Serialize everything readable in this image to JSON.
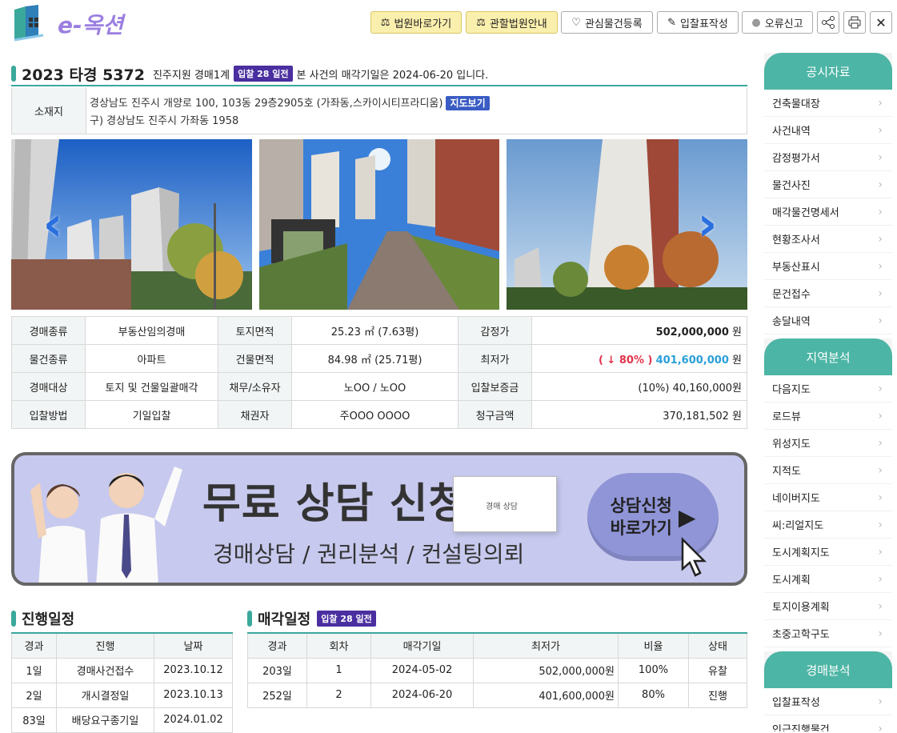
{
  "header": {
    "logo_text": "e-옥션",
    "buttons": {
      "court_link": "법원바로가기",
      "court_info": "관할법원안내",
      "favorite": "관심물건등록",
      "bid_form": "입찰표작성",
      "error_report": "오류신고"
    }
  },
  "title": {
    "case_no": "2023 타경 5372",
    "court": "진주지원 경매1계",
    "dday_badge": "입찰 28 일전",
    "sub": "본 사건의 매각기일은 2024-06-20 입니다."
  },
  "address": {
    "label": "소재지",
    "line1": "경상남도 진주시 개양로 100, 103동 29층2905호 (가좌동,스카이시티프라디움)",
    "map_button": "지도보기",
    "line2": "구) 경상남도 진주시 가좌동 1958"
  },
  "info": {
    "r1": {
      "h1": "경매종류",
      "v1": "부동산임의경매",
      "h2": "토지면적",
      "v2": "25.23 ㎡ (7.63평)",
      "h3": "감정가",
      "v3": "502,000,000",
      "unit": "원"
    },
    "r2": {
      "h1": "물건종류",
      "v1": "아파트",
      "h2": "건물면적",
      "v2": "84.98 ㎡ (25.71평)",
      "h3": "최저가",
      "v3_pct": "( ↓ 80% )",
      "v3": "401,600,000",
      "unit": "원"
    },
    "r3": {
      "h1": "경매대상",
      "v1": "토지 및 건물일괄매각",
      "h2": "채무/소유자",
      "v2": "노OO / 노OO",
      "h3": "입찰보증금",
      "v3": "(10%) 40,160,000원"
    },
    "r4": {
      "h1": "입찰방법",
      "v1": "기일입찰",
      "h2": "채권자",
      "v2": "주OOO OOOO",
      "h3": "청구금액",
      "v3": "370,181,502 원"
    }
  },
  "banner": {
    "title": "무료 상담 신청",
    "subtitle": "경매상담 / 권리분석 / 컨설팅의뢰",
    "doc_text": "경매 상담",
    "button": "상담신청\n바로가기"
  },
  "progress": {
    "title": "진행일정",
    "headers": [
      "경과",
      "진행",
      "날짜"
    ],
    "rows": [
      [
        "1일",
        "경매사건접수",
        "2023.10.12"
      ],
      [
        "2일",
        "개시결정일",
        "2023.10.13"
      ],
      [
        "83일",
        "배당요구종기일",
        "2024.01.02"
      ]
    ]
  },
  "sale": {
    "title": "매각일정",
    "badge": "입찰 28 일전",
    "headers": [
      "경과",
      "회차",
      "매각기일",
      "최저가",
      "비율",
      "상태"
    ],
    "rows": [
      [
        "203일",
        "1",
        "2024-05-02",
        "502,000,000원",
        "100%",
        "유찰"
      ],
      [
        "252일",
        "2",
        "2024-06-20",
        "401,600,000원",
        "80%",
        "진행"
      ]
    ]
  },
  "sidebar": {
    "public": {
      "title": "공시자료",
      "items": [
        "건축물대장",
        "사건내역",
        "감정평가서",
        "물건사진",
        "매각물건명세서",
        "현황조사서",
        "부동산표시",
        "문건접수",
        "송달내역"
      ]
    },
    "region": {
      "title": "지역분석",
      "items": [
        "다음지도",
        "로드뷰",
        "위성지도",
        "지적도",
        "네이버지도",
        "씨:리얼지도",
        "도시계획지도",
        "도시계획",
        "토지이용계획",
        "초중고학구도"
      ]
    },
    "auction": {
      "title": "경매분석",
      "items": [
        "입찰표작성",
        "인근진행물건"
      ]
    }
  },
  "colors": {
    "accent": "#3aa89b",
    "badge": "#4a2fa0",
    "map_button": "#3a5cc4",
    "sidebar_header": "#4db5a5",
    "red": "#e0334a",
    "blue": "#2a9fd8"
  }
}
